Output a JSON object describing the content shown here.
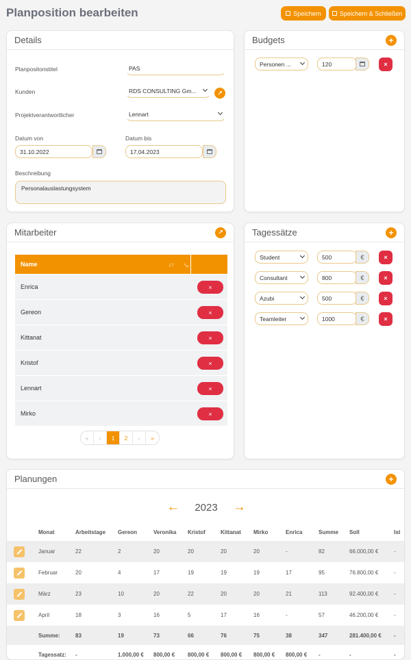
{
  "header": {
    "title": "Planposition bearbeiten",
    "save_label": "Speichern",
    "save_close_label": "Speichern & Schließen"
  },
  "details": {
    "title": "Details",
    "planposition_label": "Planpositonstitel",
    "planposition_value": "PAS",
    "kunden_label": "Kunden",
    "kunden_value": "RDS CONSULTING Gm...",
    "projekt_label": "Projektverantwortlicher",
    "projekt_value": "Lennart",
    "datum_von_label": "Datum von",
    "datum_von_value": "31.10.2022",
    "datum_bis_label": "Datum bis",
    "datum_bis_value": "17.04.2023",
    "beschreibung_label": "Beschreibung",
    "beschreibung_value": "Personalauslastungsystem"
  },
  "budgets": {
    "title": "Budgets",
    "items": [
      {
        "type": "Personen ...",
        "value": "120"
      }
    ]
  },
  "mitarbeiter": {
    "title": "Mitarbeiter",
    "column_name": "Name",
    "sort_icon": "↓↑",
    "delete_symbol": "×",
    "rows": [
      "Enrica",
      "Gereon",
      "Kittanat",
      "Kristof",
      "Lennart",
      "Mirko"
    ],
    "pager": {
      "first": "«",
      "prev": "‹",
      "page1": "1",
      "page2": "2",
      "next": "›",
      "last": "»"
    }
  },
  "tagessaetze": {
    "title": "Tagessätze",
    "currency": "€",
    "items": [
      {
        "role": "Student",
        "value": "500"
      },
      {
        "role": "Consultant",
        "value": "800"
      },
      {
        "role": "Azubi",
        "value": "500"
      },
      {
        "role": "Teamleiter",
        "value": "1000"
      }
    ]
  },
  "planungen": {
    "title": "Planungen",
    "year": "2023",
    "prev_arrow": "←",
    "next_arrow": "→",
    "columns": [
      "Monat",
      "Arbeitstage",
      "Gereon",
      "Veronika",
      "Kristof",
      "Kittanat",
      "Mirko",
      "Enrica",
      "Summe",
      "Soll",
      "Ist"
    ],
    "rows": [
      [
        "Januar",
        "22",
        "2",
        "20",
        "20",
        "20",
        "20",
        "-",
        "82",
        "66.000,00 €",
        "-"
      ],
      [
        "Februar",
        "20",
        "4",
        "17",
        "19",
        "19",
        "19",
        "17",
        "95",
        "76.800,00 €",
        "-"
      ],
      [
        "März",
        "23",
        "10",
        "20",
        "22",
        "20",
        "20",
        "21",
        "113",
        "92.400,00 €",
        "-"
      ],
      [
        "April",
        "18",
        "3",
        "16",
        "5",
        "17",
        "16",
        "-",
        "57",
        "46.200,00 €",
        "-"
      ]
    ],
    "sum_row": [
      "Summe:",
      "83",
      "19",
      "73",
      "66",
      "76",
      "75",
      "38",
      "347",
      "281.400,00 €",
      "-"
    ],
    "rate_row": [
      "Tagessatz:",
      "-",
      "1.000,00 €",
      "800,00 €",
      "800,00 €",
      "800,00 €",
      "800,00 €",
      "800,00 €",
      "-",
      "-",
      "-"
    ]
  }
}
